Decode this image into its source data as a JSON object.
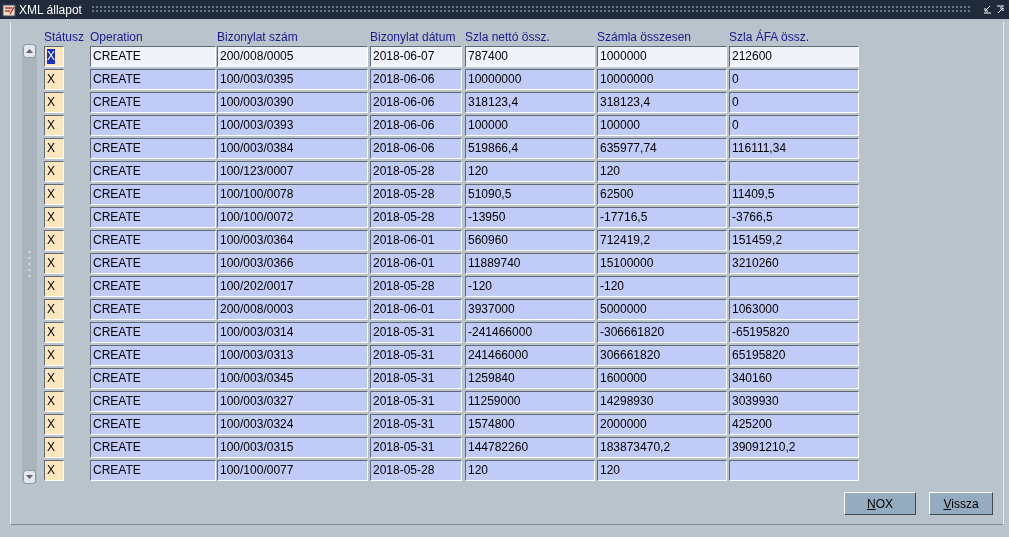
{
  "window": {
    "title": "XML állapot"
  },
  "table": {
    "columns": [
      "Státusz",
      "Operation",
      "Bizonylat szám",
      "Bizonylat dátum",
      "Szla nettó össz.",
      "Számla összesen",
      "Szla ÁFA össz."
    ],
    "rows": [
      {
        "selected": true,
        "cells": [
          "X",
          "CREATE",
          "200/008/0005",
          "2018-06-07",
          "787400",
          "1000000",
          "212600"
        ]
      },
      {
        "selected": false,
        "cells": [
          "X",
          "CREATE",
          "100/003/0395",
          "2018-06-06",
          "10000000",
          "10000000",
          "0"
        ]
      },
      {
        "selected": false,
        "cells": [
          "X",
          "CREATE",
          "100/003/0390",
          "2018-06-06",
          "318123,4",
          "318123,4",
          "0"
        ]
      },
      {
        "selected": false,
        "cells": [
          "X",
          "CREATE",
          "100/003/0393",
          "2018-06-06",
          "100000",
          "100000",
          "0"
        ]
      },
      {
        "selected": false,
        "cells": [
          "X",
          "CREATE",
          "100/003/0384",
          "2018-06-06",
          "519866,4",
          "635977,74",
          "116111,34"
        ]
      },
      {
        "selected": false,
        "cells": [
          "X",
          "CREATE",
          "100/123/0007",
          "2018-05-28",
          "120",
          "120",
          ""
        ]
      },
      {
        "selected": false,
        "cells": [
          "X",
          "CREATE",
          "100/100/0078",
          "2018-05-28",
          "51090,5",
          "62500",
          "11409,5"
        ]
      },
      {
        "selected": false,
        "cells": [
          "X",
          "CREATE",
          "100/100/0072",
          "2018-05-28",
          "-13950",
          "-17716,5",
          "-3766,5"
        ]
      },
      {
        "selected": false,
        "cells": [
          "X",
          "CREATE",
          "100/003/0364",
          "2018-06-01",
          "560960",
          "712419,2",
          "151459,2"
        ]
      },
      {
        "selected": false,
        "cells": [
          "X",
          "CREATE",
          "100/003/0366",
          "2018-06-01",
          "11889740",
          "15100000",
          "3210260"
        ]
      },
      {
        "selected": false,
        "cells": [
          "X",
          "CREATE",
          "100/202/0017",
          "2018-05-28",
          "-120",
          "-120",
          ""
        ]
      },
      {
        "selected": false,
        "cells": [
          "X",
          "CREATE",
          "200/008/0003",
          "2018-06-01",
          "3937000",
          "5000000",
          "1063000"
        ]
      },
      {
        "selected": false,
        "cells": [
          "X",
          "CREATE",
          "100/003/0314",
          "2018-05-31",
          "-241466000",
          "-306661820",
          "-65195820"
        ]
      },
      {
        "selected": false,
        "cells": [
          "X",
          "CREATE",
          "100/003/0313",
          "2018-05-31",
          "241466000",
          "306661820",
          "65195820"
        ]
      },
      {
        "selected": false,
        "cells": [
          "X",
          "CREATE",
          "100/003/0345",
          "2018-05-31",
          "1259840",
          "1600000",
          "340160"
        ]
      },
      {
        "selected": false,
        "cells": [
          "X",
          "CREATE",
          "100/003/0327",
          "2018-05-31",
          "11259000",
          "14298930",
          "3039930"
        ]
      },
      {
        "selected": false,
        "cells": [
          "X",
          "CREATE",
          "100/003/0324",
          "2018-05-31",
          "1574800",
          "2000000",
          "425200"
        ]
      },
      {
        "selected": false,
        "cells": [
          "X",
          "CREATE",
          "100/003/0315",
          "2018-05-31",
          "144782260",
          "183873470,2",
          "39091210,2"
        ]
      },
      {
        "selected": false,
        "cells": [
          "X",
          "CREATE",
          "100/100/0077",
          "2018-05-28",
          "120",
          "120",
          ""
        ]
      }
    ]
  },
  "buttons": [
    "NOX",
    "Vissza"
  ]
}
